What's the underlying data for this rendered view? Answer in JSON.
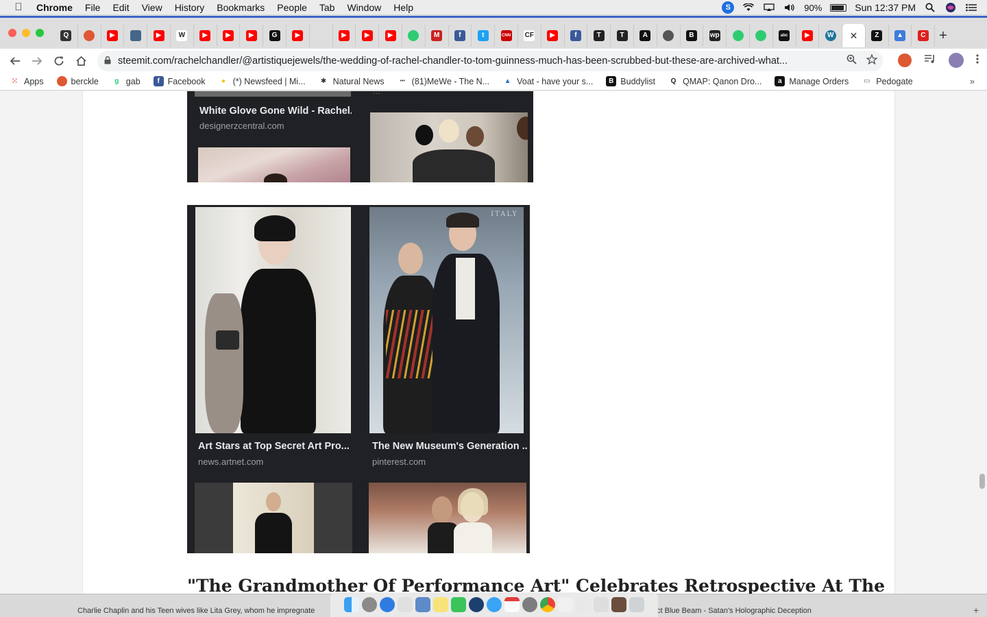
{
  "menubar": {
    "app": "Chrome",
    "items": [
      "File",
      "Edit",
      "View",
      "History",
      "Bookmarks",
      "People",
      "Tab",
      "Window",
      "Help"
    ],
    "skype_letter": "S",
    "battery_pct": "90%",
    "clock": "Sun 12:37 PM"
  },
  "tabs": [
    {
      "icon": "q-icon",
      "glyph": "Q",
      "color": "#333333"
    },
    {
      "icon": "duckduckgo-icon",
      "glyph": "",
      "color": "#de5833"
    },
    {
      "icon": "youtube-icon",
      "glyph": "▶",
      "color": "#ff0000"
    },
    {
      "icon": "image-icon",
      "glyph": "",
      "color": "#446688"
    },
    {
      "icon": "youtube-icon",
      "glyph": "▶",
      "color": "#ff0000"
    },
    {
      "icon": "wikipedia-icon",
      "glyph": "W",
      "color": "#ffffff"
    },
    {
      "icon": "youtube-icon",
      "glyph": "▶",
      "color": "#ff0000"
    },
    {
      "icon": "youtube-icon",
      "glyph": "▶",
      "color": "#ff0000"
    },
    {
      "icon": "youtube-icon",
      "glyph": "▶",
      "color": "#ff0000"
    },
    {
      "icon": "g-icon",
      "glyph": "G",
      "color": "#111111"
    },
    {
      "icon": "youtube-icon",
      "glyph": "▶",
      "color": "#ff0000"
    },
    {
      "icon": "blank-icon",
      "glyph": "",
      "color": "#dedede"
    },
    {
      "icon": "youtube-icon",
      "glyph": "▶",
      "color": "#ff0000"
    },
    {
      "icon": "youtube-icon",
      "glyph": "▶",
      "color": "#ff0000"
    },
    {
      "icon": "youtube-icon",
      "glyph": "▶",
      "color": "#ff0000"
    },
    {
      "icon": "green-circle-icon",
      "glyph": "",
      "color": "#2ecc71"
    },
    {
      "icon": "m-icon",
      "glyph": "M",
      "color": "#cc2222"
    },
    {
      "icon": "facebook-icon",
      "glyph": "f",
      "color": "#3b5998"
    },
    {
      "icon": "twitter-icon",
      "glyph": "t",
      "color": "#1da1f2"
    },
    {
      "icon": "cnn-icon",
      "glyph": "CNN",
      "color": "#cc0000"
    },
    {
      "icon": "cf-icon",
      "glyph": "CF",
      "color": "#ffffff"
    },
    {
      "icon": "youtube-icon",
      "glyph": "▶",
      "color": "#ff0000"
    },
    {
      "icon": "facebook-icon",
      "glyph": "f",
      "color": "#3b5998"
    },
    {
      "icon": "nyt-icon",
      "glyph": "T",
      "color": "#222222"
    },
    {
      "icon": "nyt-icon",
      "glyph": "T",
      "color": "#222222"
    },
    {
      "icon": "atlantic-icon",
      "glyph": "A",
      "color": "#111111"
    },
    {
      "icon": "globe-icon",
      "glyph": "",
      "color": "#555555"
    },
    {
      "icon": "b-icon",
      "glyph": "B",
      "color": "#111111"
    },
    {
      "icon": "wp-icon",
      "glyph": "wp",
      "color": "#222222"
    },
    {
      "icon": "green-circle-icon",
      "glyph": "",
      "color": "#2ecc71"
    },
    {
      "icon": "green-circle-icon",
      "glyph": "",
      "color": "#2ecc71"
    },
    {
      "icon": "abc-icon",
      "glyph": "abc",
      "color": "#111111"
    },
    {
      "icon": "youtube-icon",
      "glyph": "▶",
      "color": "#ff0000"
    },
    {
      "icon": "wordpress-icon",
      "glyph": "W",
      "color": "#21759b"
    },
    {
      "icon": "close-icon",
      "glyph": "✕",
      "color": "#ffffff",
      "active": true
    },
    {
      "icon": "z-icon",
      "glyph": "Z",
      "color": "#111111"
    },
    {
      "icon": "triangle-icon",
      "glyph": "▲",
      "color": "#3b7ddd"
    },
    {
      "icon": "c-icon",
      "glyph": "C",
      "color": "#e02020"
    }
  ],
  "toolbar": {
    "url": "steemit.com/rachelchandler/@artistiquejewels/the-wedding-of-rachel-chandler-to-tom-guinness-much-has-been-scrubbed-but-these-are-archived-what..."
  },
  "bookmarks": {
    "items": [
      {
        "label": "Apps",
        "icon": "apps-grid-icon"
      },
      {
        "label": "berckle",
        "icon": "duckduckgo-icon"
      },
      {
        "label": "gab",
        "icon": "gab-icon"
      },
      {
        "label": "Facebook",
        "icon": "facebook-icon"
      },
      {
        "label": "(*) Newsfeed | Mi...",
        "icon": "lightbulb-icon"
      },
      {
        "label": "Natural News",
        "icon": "gear-icon"
      },
      {
        "label": "(81)MeWe - The N...",
        "icon": "dots-icon"
      },
      {
        "label": "Voat - have your s...",
        "icon": "triangle-icon"
      },
      {
        "label": "Buddylist",
        "icon": "b-icon"
      },
      {
        "label": "QMAP: Qanon Dro...",
        "icon": "q-icon"
      },
      {
        "label": "Manage Orders",
        "icon": "amazon-icon"
      },
      {
        "label": "Pedogate",
        "icon": "folder-icon"
      }
    ],
    "more": "»"
  },
  "results": {
    "top_left": {
      "caption": "White Glove Gone Wild - Rachel...",
      "source": "designerzcentral.com"
    },
    "top_right_partial": "...",
    "mid_left": {
      "caption": "Art Stars at Top Secret Art Pro...",
      "source": "news.artnet.com"
    },
    "mid_right": {
      "caption": "The New Museum's Generation ...",
      "source": "pinterest.com"
    },
    "watermark": "ITALY"
  },
  "article": {
    "heading": "\"The Grandmother Of Performance Art\" Celebrates Retrospective At The"
  },
  "bottom": {
    "left_text": "Charlie Chaplin and his Teen wives like Lita Grey, whom he impregnate",
    "right_text": "ct Blue Beam - Satan's Holographic Deception"
  }
}
